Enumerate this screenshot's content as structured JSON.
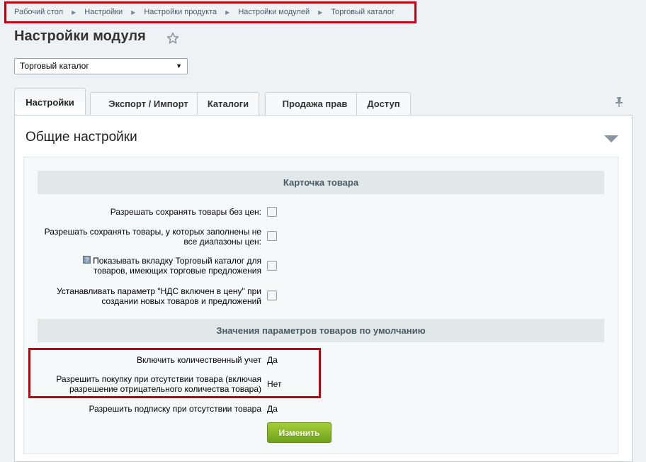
{
  "breadcrumb": [
    "Рабочий стол",
    "Настройки",
    "Настройки продукта",
    "Настройки модулей",
    "Торговый каталог"
  ],
  "page_title": "Настройки модуля",
  "module_select": {
    "selected": "Торговый каталог"
  },
  "tabs": [
    "Настройки",
    "Экспорт / Импорт",
    "Каталоги",
    "Продажа прав",
    "Доступ"
  ],
  "active_tab": "Настройки",
  "section_title": "Общие настройки",
  "product_card": {
    "heading": "Карточка товара",
    "options": [
      {
        "label": "Разрешать сохранять товары без цен:",
        "checked": false
      },
      {
        "label": "Разрешать сохранять товары, у которых заполнены не все диапазоны цен:",
        "checked": false
      },
      {
        "label": "Показывать вкладку Торговый каталог для товаров, имеющих торговые предложения",
        "checked": false,
        "help_icon": "help-icon"
      },
      {
        "label": "Устанавливать параметр \"НДС включен в цену\" при создании новых товаров и предложений",
        "checked": false
      }
    ]
  },
  "defaults": {
    "heading": "Значения параметров товаров по умолчанию",
    "rows": [
      {
        "label": "Включить количественный учет",
        "value": "Да"
      },
      {
        "label": "Разрешить покупку при отсутствии товара (включая разрешение отрицательного количества товара)",
        "value": "Нет"
      },
      {
        "label": "Разрешить подписку при отсутствии товара",
        "value": "Да"
      }
    ]
  },
  "change_button": "Изменить",
  "colors": {
    "highlight": "#c00010",
    "button_green": "#7cb32a",
    "heading_bg": "#e0e8ea"
  }
}
